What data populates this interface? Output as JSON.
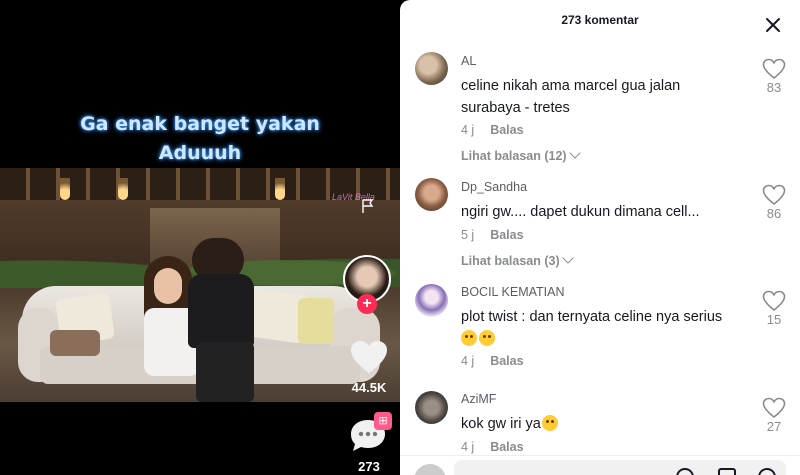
{
  "video": {
    "caption_line1": "Ga enak banget yakan",
    "caption_line2": "Aduuuh",
    "watermark": "LaVit Bella",
    "like_count": "44.5K",
    "comment_count": "273"
  },
  "comments_panel": {
    "title": "273 komentar",
    "items": [
      {
        "user": "AL",
        "text": "celine nikah ama marcel gua jalan surabaya - tretes",
        "time": "4 j",
        "reply": "Balas",
        "likes": "83",
        "view_replies": "Lihat balasan (12)"
      },
      {
        "user": "Dp_Sandha",
        "text": "ngiri gw.... dapet dukun dimana cell...",
        "time": "5 j",
        "reply": "Balas",
        "likes": "86",
        "view_replies": "Lihat balasan (3)"
      },
      {
        "user": "BOCIL KEMATIAN",
        "text": "plot twist : dan ternyata celine nya serius",
        "time": "4 j",
        "reply": "Balas",
        "likes": "15"
      },
      {
        "user": "AziMF",
        "text": "kok gw iri ya",
        "time": "4 j",
        "reply": "Balas",
        "likes": "27"
      }
    ]
  },
  "colors": {
    "accent": "#fe2c55",
    "panel_bg": "#ffffff",
    "muted_text": "#8a8b91"
  }
}
